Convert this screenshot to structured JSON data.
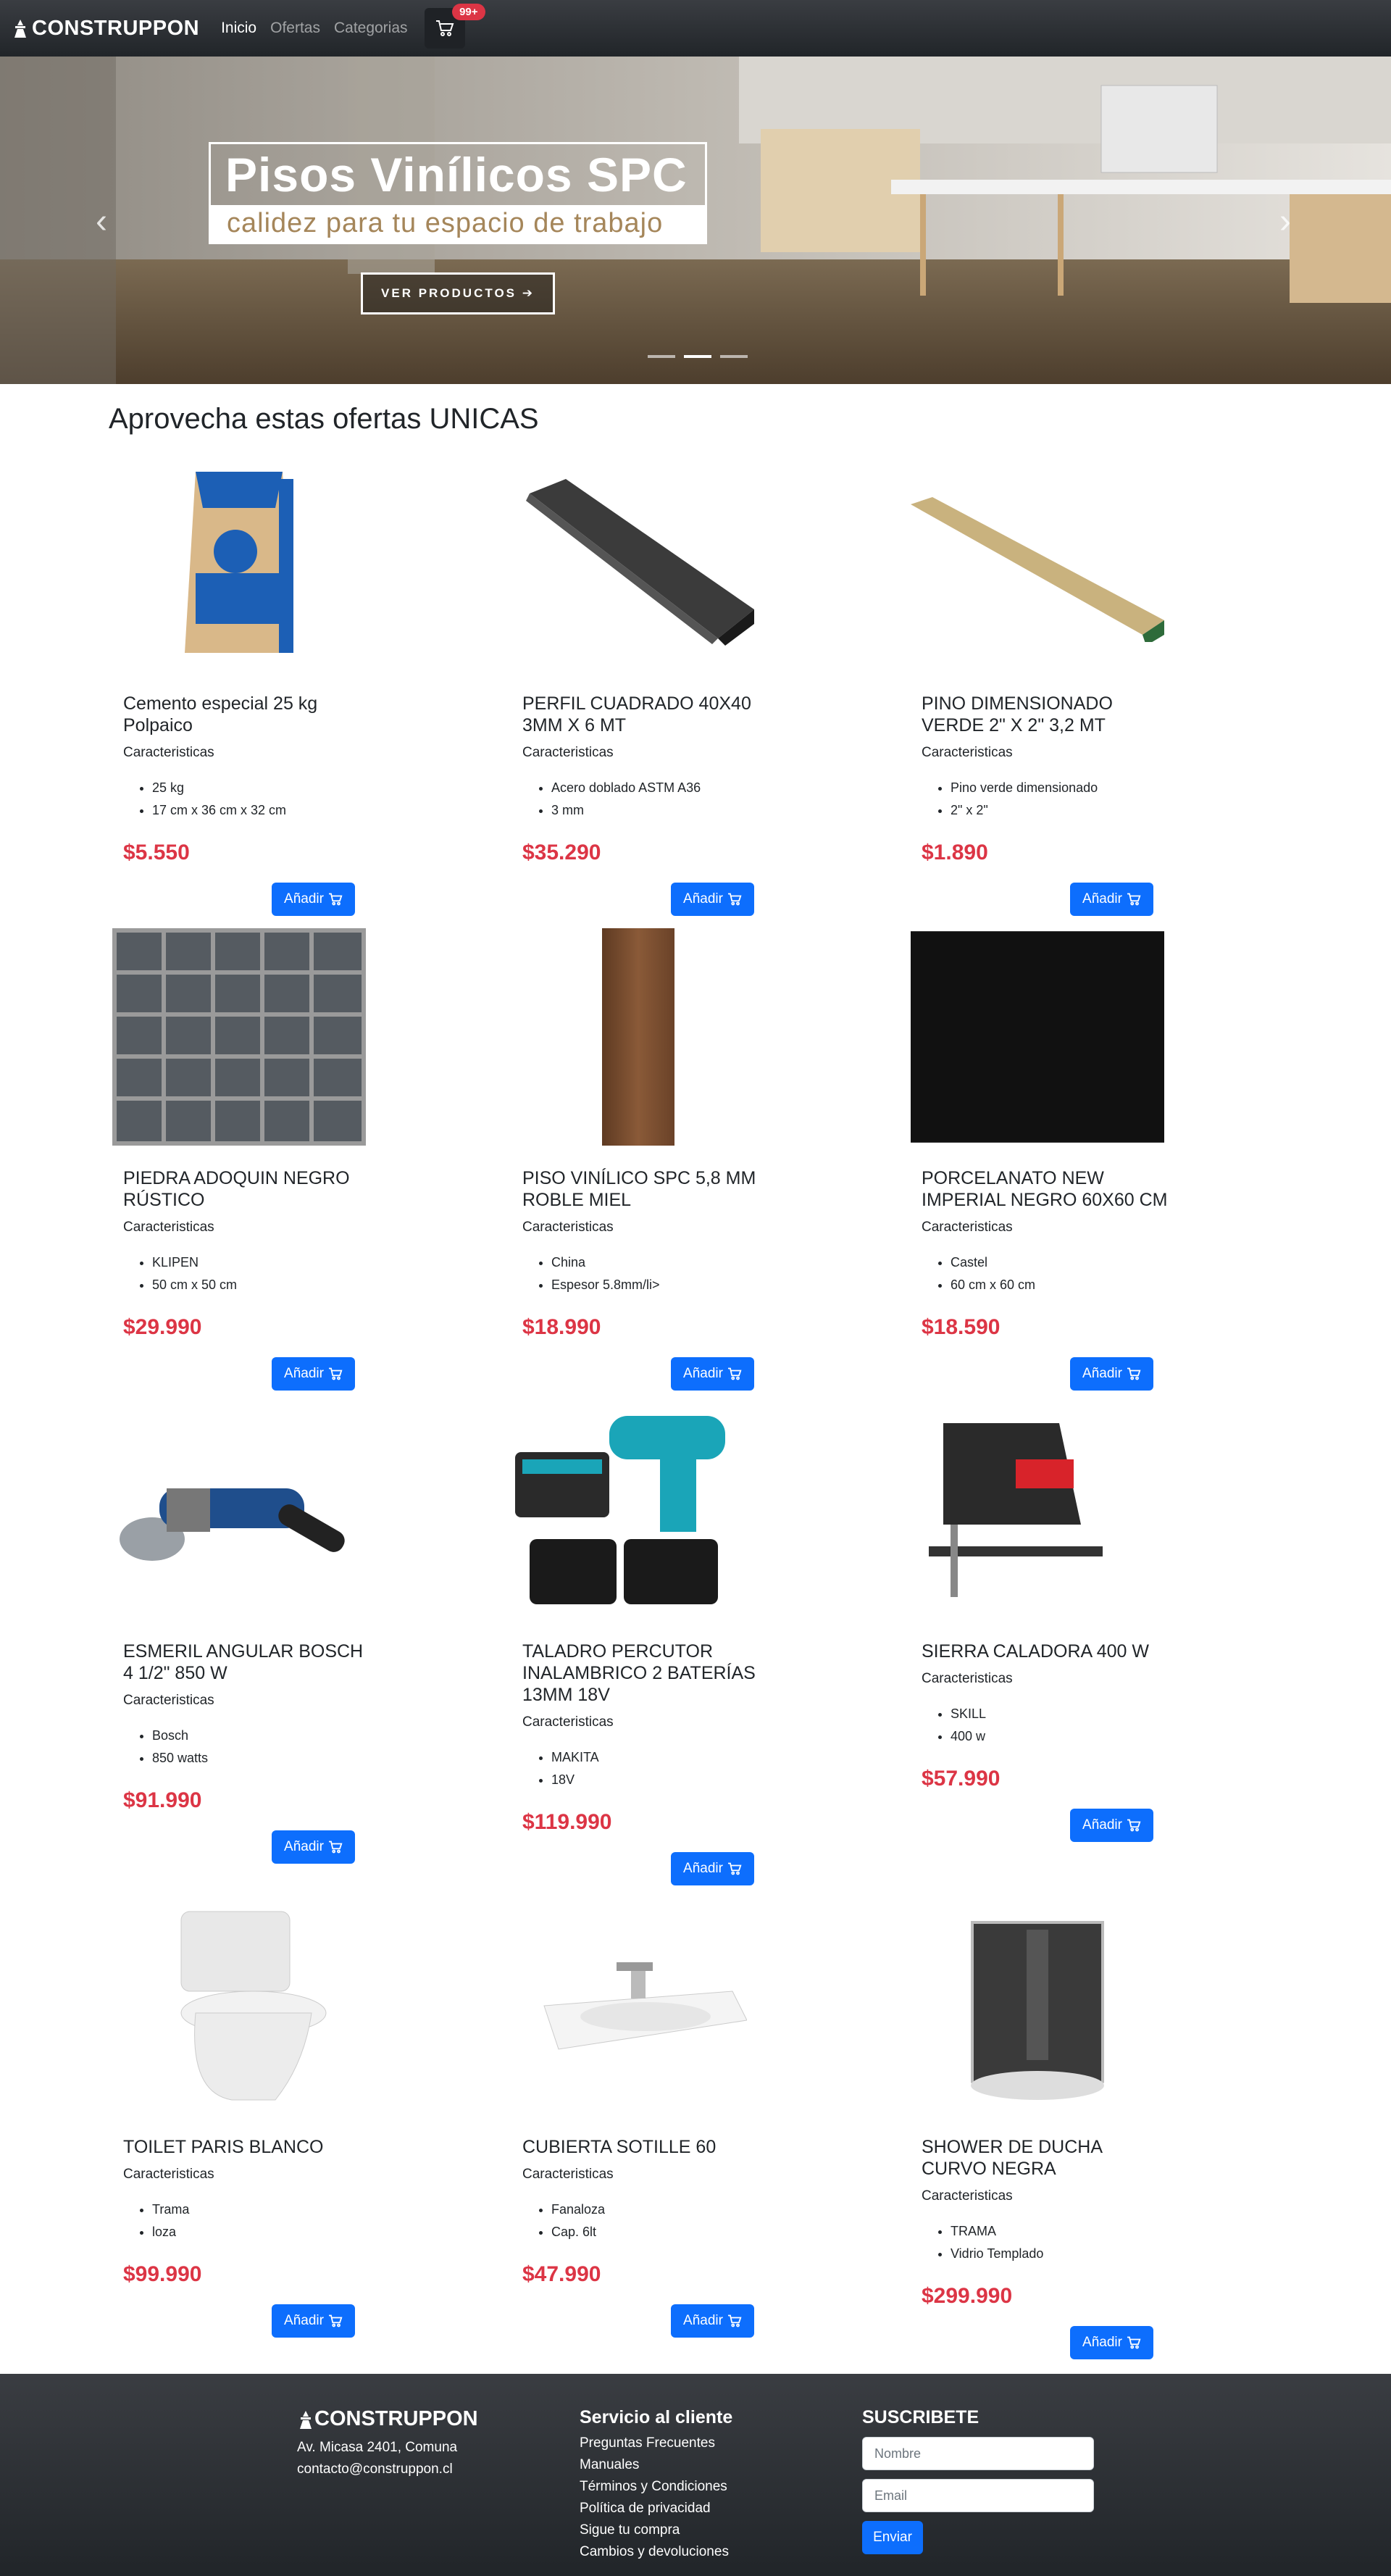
{
  "nav": {
    "brand": "CONSTRUPPON",
    "links": [
      "Inicio",
      "Ofertas",
      "Categorias"
    ],
    "cart_badge": "99+"
  },
  "hero": {
    "title": "Pisos Vinílicos SPC",
    "subtitle": "calidez para tu espacio de trabajo",
    "button": "VER PRODUCTOS ➔"
  },
  "section_title": "Aprovecha estas ofertas UNICAS",
  "products": [
    {
      "name": "Cemento especial 25 kg Polpaico",
      "features_label": "Caracteristicas",
      "features": [
        "25 kg",
        "17 cm x 36 cm x 32 cm"
      ],
      "price": "$5.550",
      "button": "Añadir",
      "icon": "cement-bag-image"
    },
    {
      "name": "PERFIL CUADRADO 40X40 3MM X 6 MT",
      "features_label": "Caracteristicas",
      "features": [
        "Acero doblado ASTM A36",
        "3 mm"
      ],
      "price": "$35.290",
      "button": "Añadir",
      "icon": "steel-profile-image"
    },
    {
      "name": "PINO DIMENSIONADO VERDE 2\" X 2\" 3,2 MT",
      "features_label": "Caracteristicas",
      "features": [
        "Pino verde dimensionado",
        "2\" x 2\""
      ],
      "price": "$1.890",
      "button": "Añadir",
      "icon": "pine-wood-image"
    },
    {
      "name": "PIEDRA ADOQUIN NEGRO RÚSTICO",
      "features_label": "Caracteristicas",
      "features": [
        "KLIPEN",
        "50 cm x 50 cm"
      ],
      "price": "$29.990",
      "button": "Añadir",
      "icon": "stone-tile-image"
    },
    {
      "name": "PISO VINÍLICO SPC 5,8 MM ROBLE MIEL",
      "features_label": "Caracteristicas",
      "features": [
        "China",
        "Espesor 5.8mm/li>"
      ],
      "price": "$18.990",
      "button": "Añadir",
      "icon": "vinyl-floor-image"
    },
    {
      "name": "PORCELANATO NEW IMPERIAL NEGRO 60X60 CM",
      "features_label": "Caracteristicas",
      "features": [
        "Castel",
        "60 cm x 60 cm"
      ],
      "price": "$18.590",
      "button": "Añadir",
      "icon": "porcelain-tile-image"
    },
    {
      "name": "ESMERIL ANGULAR BOSCH 4 1/2\" 850 W",
      "features_label": "Caracteristicas",
      "features": [
        "Bosch",
        "850 watts"
      ],
      "price": "$91.990",
      "button": "Añadir",
      "icon": "angle-grinder-image"
    },
    {
      "name": "TALADRO PERCUTOR INALAMBRICO 2 BATERÍAS 13MM 18V",
      "features_label": "Caracteristicas",
      "features": [
        "MAKITA",
        "18V"
      ],
      "price": "$119.990",
      "button": "Añadir",
      "icon": "drill-image"
    },
    {
      "name": "SIERRA CALADORA 400 W",
      "features_label": "Caracteristicas",
      "features": [
        "SKILL",
        "400 w"
      ],
      "price": "$57.990",
      "button": "Añadir",
      "icon": "jigsaw-image"
    },
    {
      "name": "TOILET PARIS BLANCO",
      "features_label": "Caracteristicas",
      "features": [
        "Trama",
        "loza"
      ],
      "price": "$99.990",
      "button": "Añadir",
      "icon": "toilet-image"
    },
    {
      "name": "CUBIERTA SOTILLE 60",
      "features_label": "Caracteristicas",
      "features": [
        "Fanaloza",
        "Cap. 6lt"
      ],
      "price": "$47.990",
      "button": "Añadir",
      "icon": "sink-image"
    },
    {
      "name": "SHOWER DE DUCHA CURVO NEGRA",
      "features_label": "Caracteristicas",
      "features": [
        "TRAMA",
        "Vidrio Templado"
      ],
      "price": "$299.990",
      "button": "Añadir",
      "icon": "shower-image"
    }
  ],
  "footer": {
    "brand": "CONSTRUPPON",
    "address": "Av. Micasa 2401, Comuna",
    "email": "contacto@construppon.cl",
    "service_title": "Servicio al cliente",
    "service_links": [
      "Preguntas Frecuentes",
      "Manuales",
      "Términos y Condiciones",
      "Política de privacidad",
      "Sigue tu compra",
      "Cambios y devoluciones"
    ],
    "subscribe_title": "SUSCRIBETE",
    "name_placeholder": "Nombre",
    "email_placeholder": "Email",
    "send": "Enviar"
  },
  "colors": {
    "primary": "#0d6efd",
    "price": "#dc3545",
    "dark": "#212529"
  }
}
